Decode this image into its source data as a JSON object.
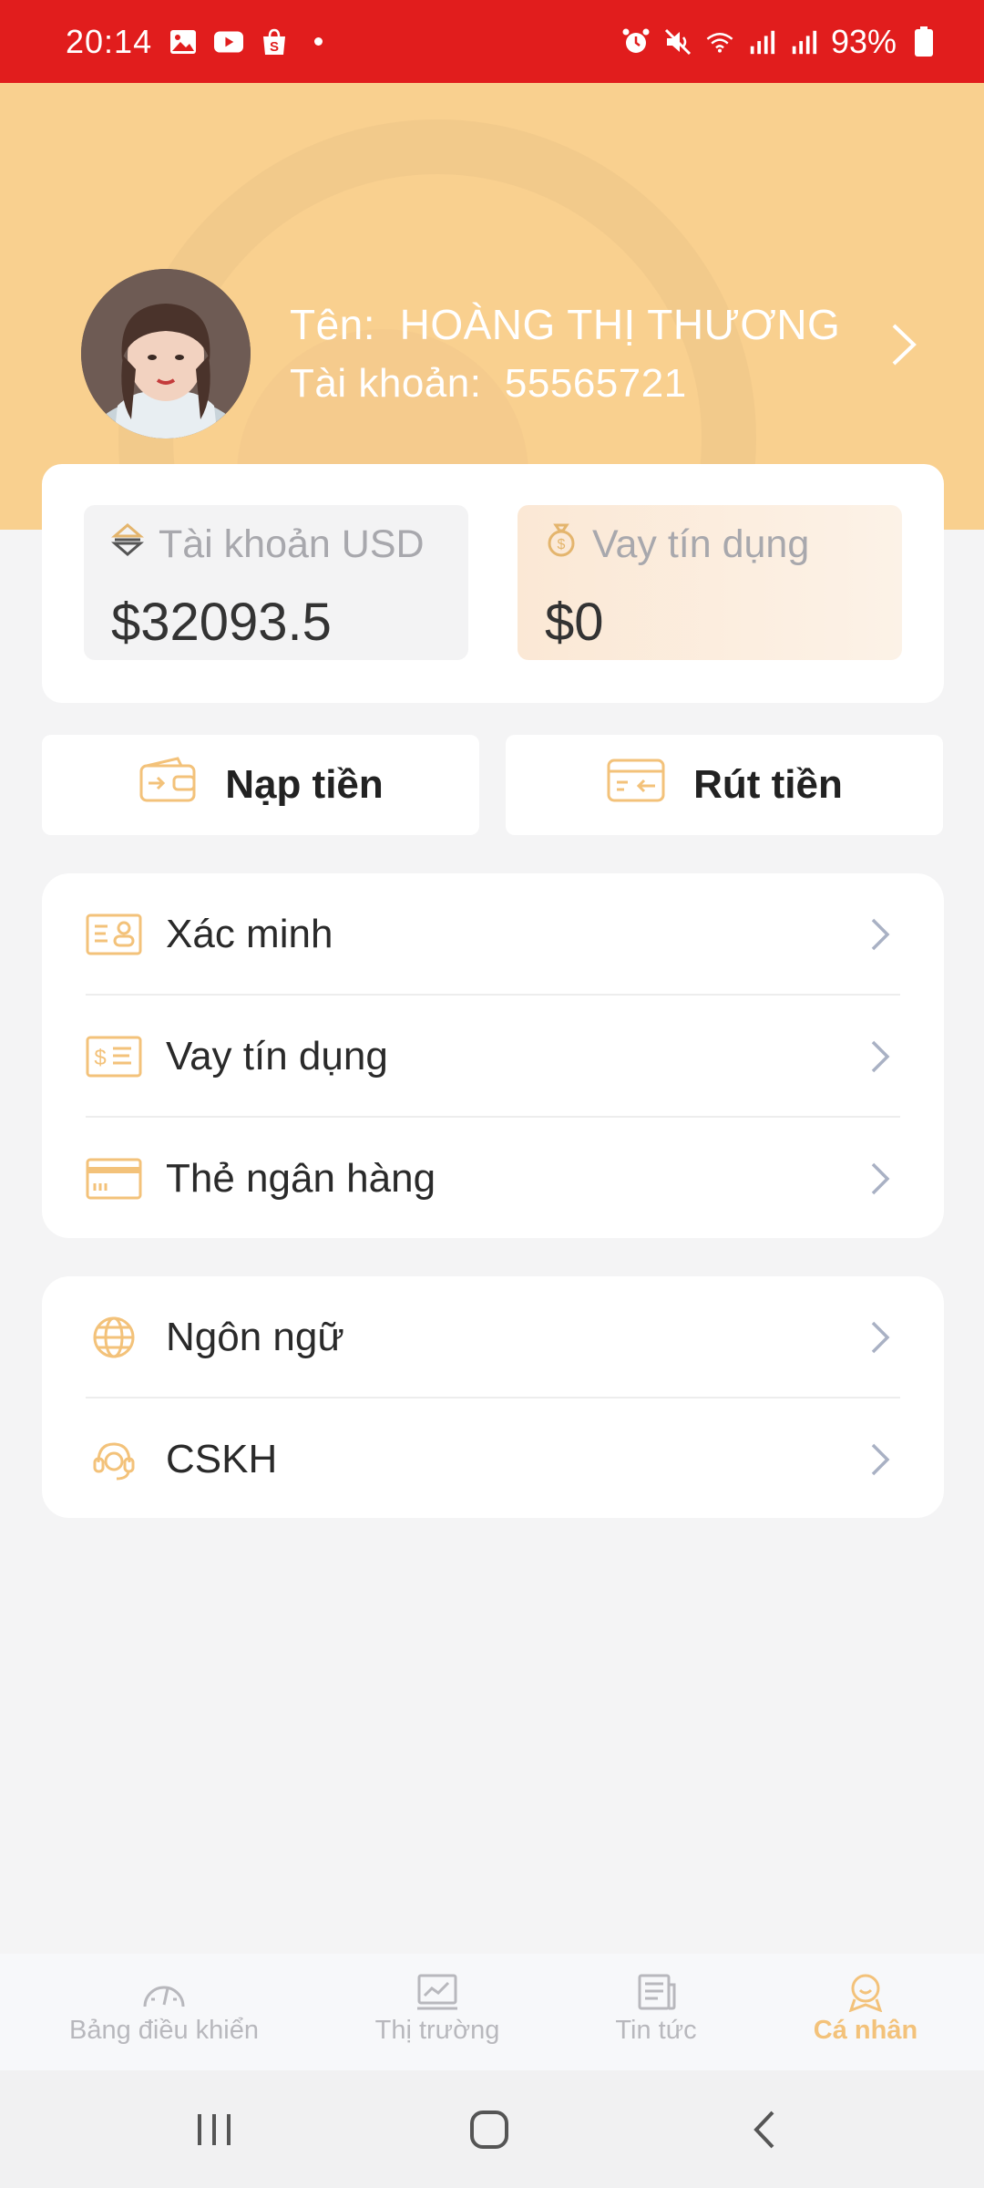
{
  "status_bar": {
    "time": "20:14",
    "battery": "93%",
    "left_icons": [
      "gallery-icon",
      "youtube-icon",
      "shopee-icon",
      "dot-icon"
    ],
    "right_icons": [
      "alarm-icon",
      "mute-icon",
      "wifi-icon",
      "signal-icon",
      "signal-icon",
      "battery-icon"
    ]
  },
  "profile": {
    "name_label": "Tên:",
    "name": "HOÀNG THỊ THƯƠNG",
    "account_label": "Tài khoản:",
    "account_number": "55565721"
  },
  "balances": {
    "usd_label": "Tài khoản USD",
    "usd_value": "$32093.5",
    "loan_label": "Vay tín dụng",
    "loan_value": "$0"
  },
  "actions": {
    "deposit_label": "Nạp tiền",
    "withdraw_label": "Rút tiền"
  },
  "menu_group_1": [
    {
      "label": "Xác minh",
      "icon": "id-card-icon"
    },
    {
      "label": "Vay tín dụng",
      "icon": "loan-bill-icon"
    },
    {
      "label": "Thẻ ngân hàng",
      "icon": "bank-card-icon"
    }
  ],
  "menu_group_2": [
    {
      "label": "Ngôn ngữ",
      "icon": "globe-icon"
    },
    {
      "label": "CSKH",
      "icon": "headset-icon"
    }
  ],
  "tab_bar": {
    "items": [
      {
        "label": "Bảng điều khiển",
        "icon": "dashboard-gauge-icon"
      },
      {
        "label": "Thị trường",
        "icon": "market-chart-icon"
      },
      {
        "label": "Tin tức",
        "icon": "news-icon"
      },
      {
        "label": "Cá nhân",
        "icon": "profile-icon"
      }
    ],
    "active_index": 3
  },
  "colors": {
    "status_bar": "#e11d1d",
    "header_bg": "#f9d08f",
    "accent": "#f3c27a",
    "page_bg": "#f4f4f5"
  }
}
